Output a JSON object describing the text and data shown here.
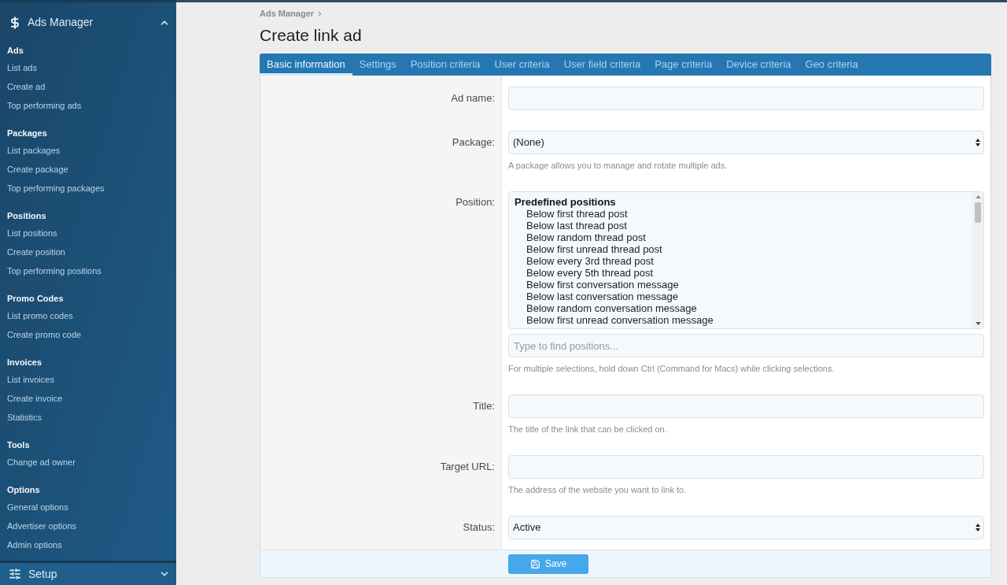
{
  "sidebar": {
    "header": {
      "title": "Ads Manager",
      "expanded": true
    },
    "sections": [
      {
        "heading": "Ads",
        "items": [
          {
            "label": "List ads",
            "selected": false
          },
          {
            "label": "Create ad",
            "selected": false
          },
          {
            "label": "Top performing ads",
            "selected": false
          }
        ]
      },
      {
        "heading": "Packages",
        "items": [
          {
            "label": "List packages",
            "selected": false
          },
          {
            "label": "Create package",
            "selected": false
          },
          {
            "label": "Top performing packages",
            "selected": false
          }
        ]
      },
      {
        "heading": "Positions",
        "items": [
          {
            "label": "List positions",
            "selected": false
          },
          {
            "label": "Create position",
            "selected": false
          },
          {
            "label": "Top performing positions",
            "selected": false
          }
        ]
      },
      {
        "heading": "Promo Codes",
        "items": [
          {
            "label": "List promo codes",
            "selected": false
          },
          {
            "label": "Create promo code",
            "selected": false
          }
        ]
      },
      {
        "heading": "Invoices",
        "items": [
          {
            "label": "List invoices",
            "selected": false
          },
          {
            "label": "Create invoice",
            "selected": false
          },
          {
            "label": "Statistics",
            "selected": false
          }
        ]
      },
      {
        "heading": "Tools",
        "items": [
          {
            "label": "Change ad owner",
            "selected": false
          }
        ]
      },
      {
        "heading": "Options",
        "items": [
          {
            "label": "General options",
            "selected": false
          },
          {
            "label": "Advertiser options",
            "selected": false
          },
          {
            "label": "Admin options",
            "selected": false
          }
        ]
      }
    ],
    "footer_section": {
      "title": "Setup",
      "expanded": false
    }
  },
  "breadcrumb": [
    {
      "label": "Ads Manager"
    }
  ],
  "page_title": "Create link ad",
  "tabs": [
    {
      "label": "Basic information",
      "selected": true
    },
    {
      "label": "Settings",
      "selected": false
    },
    {
      "label": "Position criteria",
      "selected": false
    },
    {
      "label": "User criteria",
      "selected": false
    },
    {
      "label": "User field criteria",
      "selected": false
    },
    {
      "label": "Page criteria",
      "selected": false
    },
    {
      "label": "Device criteria",
      "selected": false
    },
    {
      "label": "Geo criteria",
      "selected": false
    }
  ],
  "form": {
    "rows": [
      {
        "kind": "text",
        "label": "Ad name:"
      },
      {
        "kind": "select",
        "label": "Package:",
        "value": "(None)",
        "hint": "A package allows you to manage and rotate multiple ads."
      },
      {
        "kind": "listbox",
        "label": "Position:",
        "group": "Predefined positions",
        "options": [
          {
            "label": "Below first thread post",
            "selected": false
          },
          {
            "label": "Below last thread post",
            "selected": false
          },
          {
            "label": "Below random thread post",
            "selected": false
          },
          {
            "label": "Below first unread thread post",
            "selected": false
          },
          {
            "label": "Below every 3rd thread post",
            "selected": false
          },
          {
            "label": "Below every 5th thread post",
            "selected": false
          },
          {
            "label": "Below first conversation message",
            "selected": false
          },
          {
            "label": "Below last conversation message",
            "selected": false
          },
          {
            "label": "Below random conversation message",
            "selected": false
          },
          {
            "label": "Below first unread conversation message",
            "selected": false
          }
        ],
        "search_placeholder": "Type to find positions...",
        "hint": "For multiple selections, hold down Ctrl (Command for Macs) while clicking selections."
      },
      {
        "kind": "text",
        "label": "Title:",
        "hint": "The title of the link that can be clicked on."
      },
      {
        "kind": "text",
        "label": "Target URL:",
        "hint": "The address of the website you want to link to."
      },
      {
        "kind": "select",
        "label": "Status:",
        "value": "Active"
      }
    ],
    "submit": {
      "label": "Save"
    }
  }
}
